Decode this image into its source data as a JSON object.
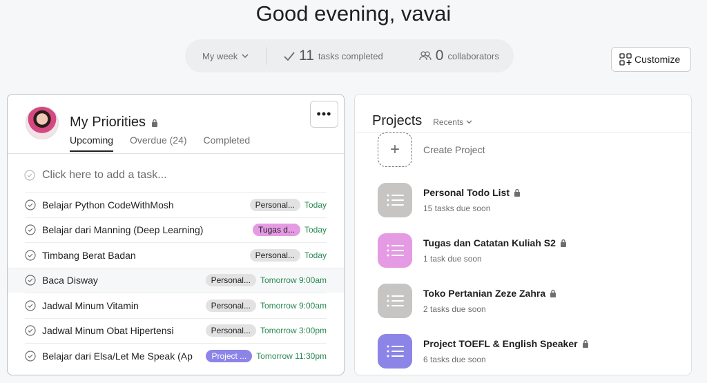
{
  "greeting": "Good evening, vavai",
  "stats": {
    "period": "My week",
    "tasks_completed_count": "11",
    "tasks_completed_label": "tasks completed",
    "collaborators_count": "0",
    "collaborators_label": "collaborators"
  },
  "customize_label": "Customize",
  "priorities": {
    "title": "My Priorities",
    "tabs": [
      {
        "label": "Upcoming",
        "active": true
      },
      {
        "label": "Overdue (24)",
        "active": false
      },
      {
        "label": "Completed",
        "active": false
      }
    ],
    "add_task_placeholder": "Click here to add a task...",
    "tasks": [
      {
        "name": "Belajar Python CodeWithMosh",
        "tag": "Personal...",
        "tag_color": "#e2e2e2",
        "due": "Today"
      },
      {
        "name": "Belajar dari Manning (Deep Learning)",
        "tag": "Tugas d...",
        "tag_color": "#e59be3",
        "due": "Today"
      },
      {
        "name": "Timbang Berat Badan",
        "tag": "Personal...",
        "tag_color": "#e2e2e2",
        "due": "Today"
      },
      {
        "name": "Baca Disway",
        "tag": "Personal...",
        "tag_color": "#e2e2e2",
        "due": "Tomorrow 9:00am"
      },
      {
        "name": "Jadwal Minum Vitamin",
        "tag": "Personal...",
        "tag_color": "#e2e2e2",
        "due": "Tomorrow 9:00am"
      },
      {
        "name": "Jadwal Minum Obat Hipertensi",
        "tag": "Personal...",
        "tag_color": "#e2e2e2",
        "due": "Tomorrow 3:00pm"
      },
      {
        "name": "Belajar dari Elsa/Let Me Speak (Ap",
        "tag": "Project ...",
        "tag_color": "#8d84e8",
        "due": "Tomorrow 11:30pm"
      }
    ]
  },
  "projects": {
    "title": "Projects",
    "filter": "Recents",
    "create_label": "Create Project",
    "items": [
      {
        "name": "Personal Todo List",
        "sub": "15 tasks due soon",
        "color": "#c7c4c4"
      },
      {
        "name": "Tugas dan Catatan Kuliah S2",
        "sub": "1 task due soon",
        "color": "#e59be3"
      },
      {
        "name": "Toko Pertanian Zeze Zahra",
        "sub": "2 tasks due soon",
        "color": "#c7c4c4"
      },
      {
        "name": "Project TOEFL & English Speaker",
        "sub": "6 tasks due soon",
        "color": "#8d84e8"
      }
    ]
  },
  "colors": {
    "due_green": "#2a8a54",
    "text_dark": "#1e1f21",
    "text_muted": "#6d6e6f"
  }
}
